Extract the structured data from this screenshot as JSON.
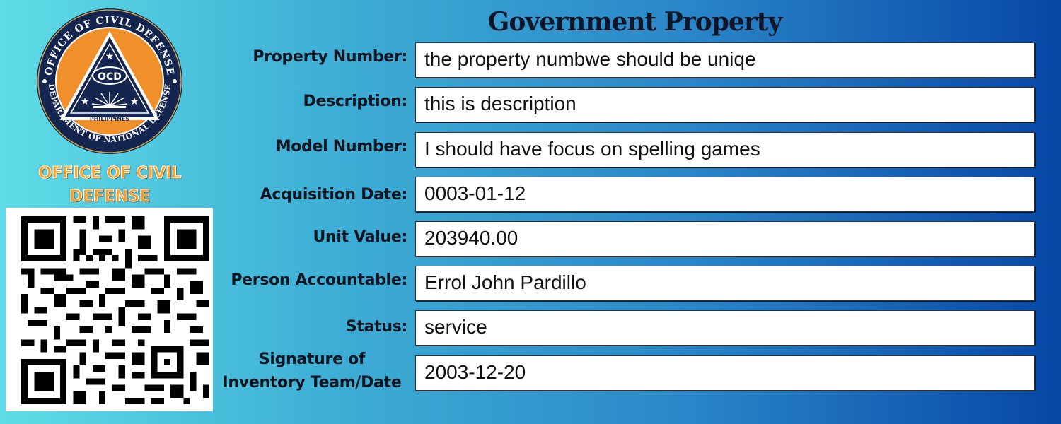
{
  "seal": {
    "ring_top": "OFFICE OF CIVIL DEFENSE",
    "ring_bottom": "DEPARTMENT OF NATIONAL DEFENSE",
    "center_abbrev": "OCD",
    "country": "PHILIPPINES",
    "colors": {
      "navy": "#14254f",
      "orange": "#f0902a",
      "white": "#ffffff"
    }
  },
  "agency": {
    "line1": "OFFICE OF CIVIL",
    "line2": "DEFENSE"
  },
  "title": "Government Property",
  "fields": {
    "property_number": {
      "label": "Property Number:",
      "value": "the property numbwe should be uniqe"
    },
    "description": {
      "label": "Description:",
      "value": "this is description"
    },
    "model_number": {
      "label": "Model Number:",
      "value": "I should have focus on spelling games"
    },
    "acquisition_date": {
      "label": "Acquisition Date:",
      "value": "0003-01-12"
    },
    "unit_value": {
      "label": "Unit Value:",
      "value": "203940.00"
    },
    "person_accountable": {
      "label": "Person Accountable:",
      "value": "Errol John Pardillo"
    },
    "status": {
      "label": "Status:",
      "value": "service"
    },
    "signature": {
      "label_line1": "Signature of",
      "label_line2": "Inventory Team/Date",
      "value": "2003-12-20"
    }
  },
  "colors": {
    "gradient_start": "#5fdde6",
    "gradient_end": "#0747a6",
    "agency_text": "#f6a12b"
  }
}
